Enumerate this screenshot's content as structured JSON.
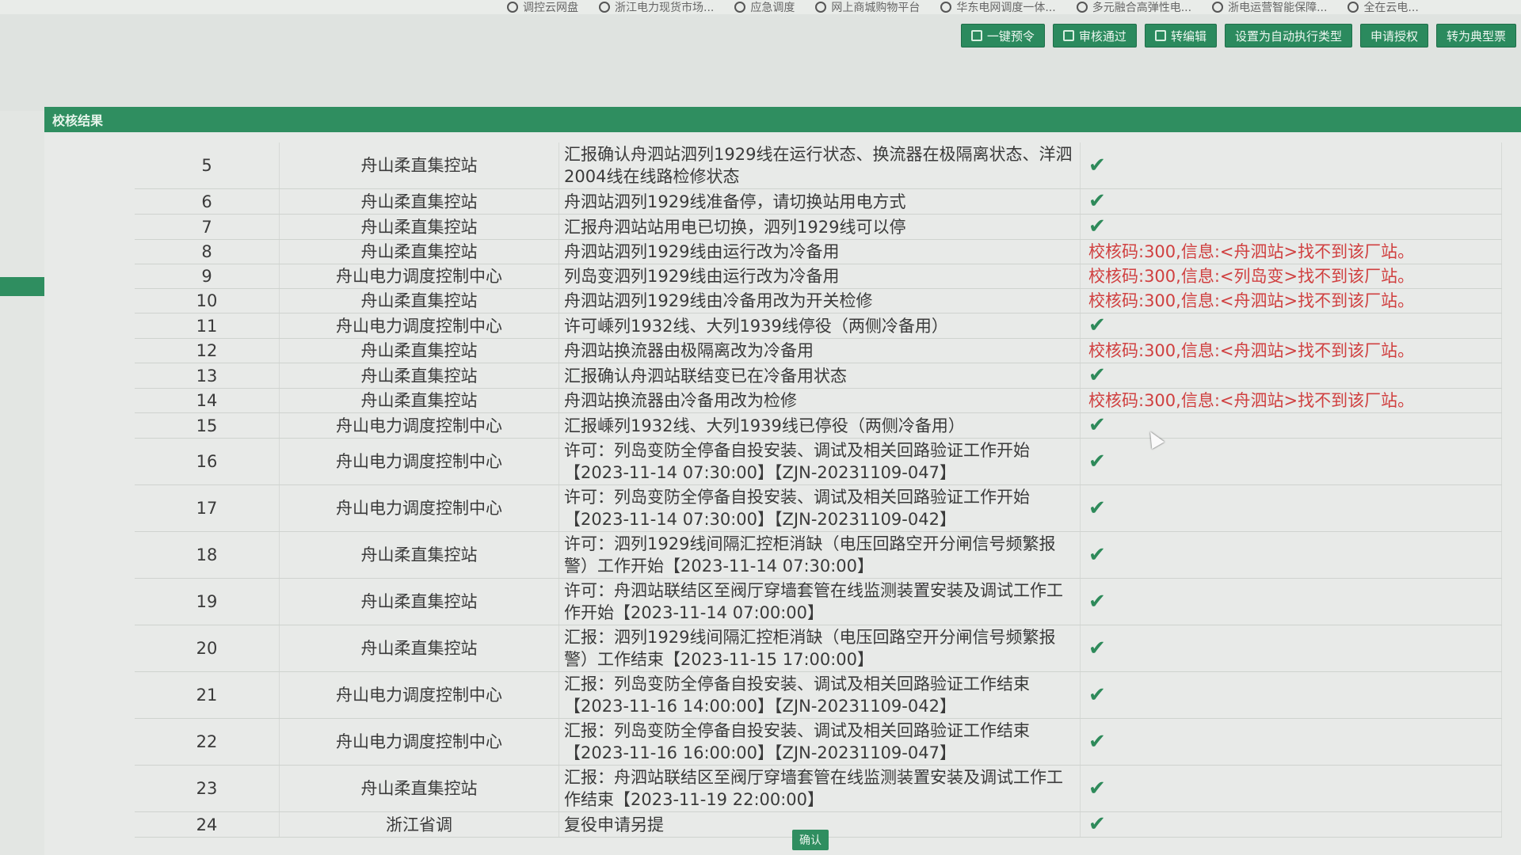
{
  "bookmarks": [
    {
      "label": "调控云网盘"
    },
    {
      "label": "浙江电力现货市场..."
    },
    {
      "label": "应急调度"
    },
    {
      "label": "网上商城购物平台"
    },
    {
      "label": "华东电网调度一体..."
    },
    {
      "label": "多元融合高弹性电..."
    },
    {
      "label": "浙电运营智能保障..."
    },
    {
      "label": "全在云电..."
    }
  ],
  "toolbar": [
    {
      "label": "一键预令",
      "icon": "person-icon"
    },
    {
      "label": "审核通过",
      "icon": "document-icon"
    },
    {
      "label": "转编辑",
      "icon": "edit-icon"
    },
    {
      "label": "设置为自动执行类型",
      "icon": ""
    },
    {
      "label": "申请授权",
      "icon": ""
    },
    {
      "label": "转为典型票",
      "icon": ""
    }
  ],
  "dialog": {
    "title": "校核结果",
    "confirm_label": "确认"
  },
  "rows": [
    {
      "no": "5",
      "unit": "舟山柔直集控站",
      "cmd": "汇报确认舟泗站泗列1929线在运行状态、换流器在极隔离状态、洋泗2004线在线路检修状态",
      "ok": true,
      "msg": ""
    },
    {
      "no": "6",
      "unit": "舟山柔直集控站",
      "cmd": "舟泗站泗列1929线准备停，请切换站用电方式",
      "ok": true,
      "msg": ""
    },
    {
      "no": "7",
      "unit": "舟山柔直集控站",
      "cmd": "汇报舟泗站站用电已切换，泗列1929线可以停",
      "ok": true,
      "msg": ""
    },
    {
      "no": "8",
      "unit": "舟山柔直集控站",
      "cmd": "舟泗站泗列1929线由运行改为冷备用",
      "ok": false,
      "msg": "校核码:300,信息:<舟泗站>找不到该厂站。"
    },
    {
      "no": "9",
      "unit": "舟山电力调度控制中心",
      "cmd": "列岛变泗列1929线由运行改为冷备用",
      "ok": false,
      "msg": "校核码:300,信息:<列岛变>找不到该厂站。"
    },
    {
      "no": "10",
      "unit": "舟山柔直集控站",
      "cmd": "舟泗站泗列1929线由冷备用改为开关检修",
      "ok": false,
      "msg": "校核码:300,信息:<舟泗站>找不到该厂站。"
    },
    {
      "no": "11",
      "unit": "舟山电力调度控制中心",
      "cmd": "许可嵊列1932线、大列1939线停役（两侧冷备用）",
      "ok": true,
      "msg": ""
    },
    {
      "no": "12",
      "unit": "舟山柔直集控站",
      "cmd": "舟泗站换流器由极隔离改为冷备用",
      "ok": false,
      "msg": "校核码:300,信息:<舟泗站>找不到该厂站。"
    },
    {
      "no": "13",
      "unit": "舟山柔直集控站",
      "cmd": "汇报确认舟泗站联结变已在冷备用状态",
      "ok": true,
      "msg": ""
    },
    {
      "no": "14",
      "unit": "舟山柔直集控站",
      "cmd": "舟泗站换流器由冷备用改为检修",
      "ok": false,
      "msg": "校核码:300,信息:<舟泗站>找不到该厂站。"
    },
    {
      "no": "15",
      "unit": "舟山电力调度控制中心",
      "cmd": "汇报嵊列1932线、大列1939线已停役（两侧冷备用）",
      "ok": true,
      "msg": ""
    },
    {
      "no": "16",
      "unit": "舟山电力调度控制中心",
      "cmd": "许可：列岛变防全停备自投安装、调试及相关回路验证工作开始【2023-11-14 07:30:00】【ZJN-20231109-047】",
      "ok": true,
      "msg": ""
    },
    {
      "no": "17",
      "unit": "舟山电力调度控制中心",
      "cmd": "许可：列岛变防全停备自投安装、调试及相关回路验证工作开始【2023-11-14 07:30:00】【ZJN-20231109-042】",
      "ok": true,
      "msg": ""
    },
    {
      "no": "18",
      "unit": "舟山柔直集控站",
      "cmd": "许可：泗列1929线间隔汇控柜消缺（电压回路空开分闸信号频繁报警）工作开始【2023-11-14 07:30:00】",
      "ok": true,
      "msg": ""
    },
    {
      "no": "19",
      "unit": "舟山柔直集控站",
      "cmd": "许可：舟泗站联结区至阀厅穿墙套管在线监测装置安装及调试工作工作开始【2023-11-14 07:00:00】",
      "ok": true,
      "msg": ""
    },
    {
      "no": "20",
      "unit": "舟山柔直集控站",
      "cmd": "汇报：泗列1929线间隔汇控柜消缺（电压回路空开分闸信号频繁报警）工作结束【2023-11-15 17:00:00】",
      "ok": true,
      "msg": ""
    },
    {
      "no": "21",
      "unit": "舟山电力调度控制中心",
      "cmd": "汇报：列岛变防全停备自投安装、调试及相关回路验证工作结束【2023-11-16 14:00:00】【ZJN-20231109-042】",
      "ok": true,
      "msg": ""
    },
    {
      "no": "22",
      "unit": "舟山电力调度控制中心",
      "cmd": "汇报：列岛变防全停备自投安装、调试及相关回路验证工作结束【2023-11-16 16:00:00】【ZJN-20231109-047】",
      "ok": true,
      "msg": ""
    },
    {
      "no": "23",
      "unit": "舟山柔直集控站",
      "cmd": "汇报：舟泗站联结区至阀厅穿墙套管在线监测装置安装及调试工作工作结束【2023-11-19 22:00:00】",
      "ok": true,
      "msg": ""
    },
    {
      "no": "24",
      "unit": "浙江省调",
      "cmd": "复役申请另提",
      "ok": true,
      "msg": ""
    }
  ]
}
